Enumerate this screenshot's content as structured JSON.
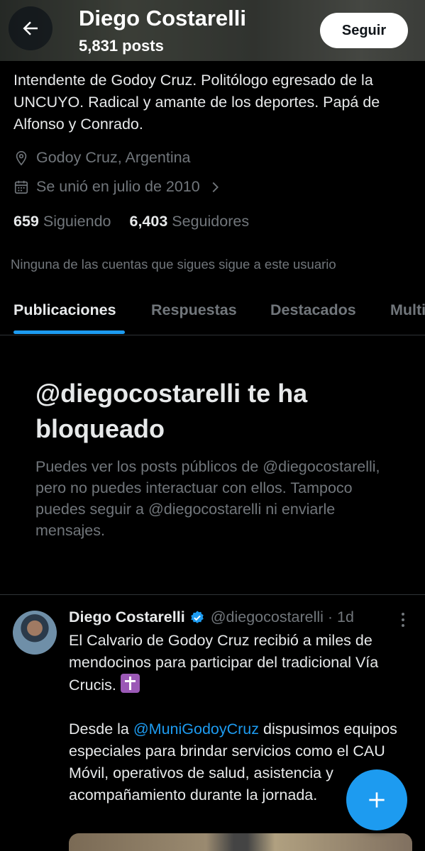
{
  "header": {
    "name": "Diego Costarelli",
    "posts_count": "5,831 posts",
    "follow_label": "Seguir"
  },
  "profile": {
    "bio": "Intendente de Godoy Cruz. Politólogo egresado de la UNCUYO. Radical y amante de los deportes. Papá de Alfonso y Conrado.",
    "location": "Godoy Cruz, Argentina",
    "joined": "Se unió en julio de 2010",
    "following_count": "659",
    "following_label": "Siguiendo",
    "followers_count": "6,403",
    "followers_label": "Seguidores",
    "mutual_note": "Ninguna de las cuentas que sigues sigue a este usuario"
  },
  "tabs": [
    {
      "label": "Publicaciones",
      "active": true
    },
    {
      "label": "Respuestas",
      "active": false
    },
    {
      "label": "Destacados",
      "active": false
    },
    {
      "label": "Multimedia",
      "active": false
    }
  ],
  "blocked": {
    "title": "@diegocostarelli te ha bloqueado",
    "text": "Puedes ver los posts públicos de @diegocostarelli, pero no puedes interactuar con ellos. Tampoco puedes seguir a @diegocostarelli ni enviarle mensajes."
  },
  "post": {
    "author": "Diego Costarelli",
    "handle": "@diegocostarelli · 1d",
    "text_line1": "El Calvario de Godoy Cruz recibió a miles de mendocinos para participar del tradicional Vía Crucis.",
    "text_pre": "Desde la ",
    "mention": "@MuniGodoyCruz",
    "text_post": " dispusimos equipos especiales para brindar servicios como el CAU Móvil, operativos de salud, asistencia y acompañamiento durante la jornada."
  },
  "colors": {
    "accent": "#1d9bf0",
    "background": "#000000",
    "muted_text": "#71767b",
    "primary_text": "#e7e9ea"
  },
  "icons": [
    "back-arrow-icon",
    "location-pin-icon",
    "calendar-icon",
    "chevron-right-icon",
    "verified-badge-icon",
    "more-options-icon",
    "compose-plus-icon"
  ]
}
